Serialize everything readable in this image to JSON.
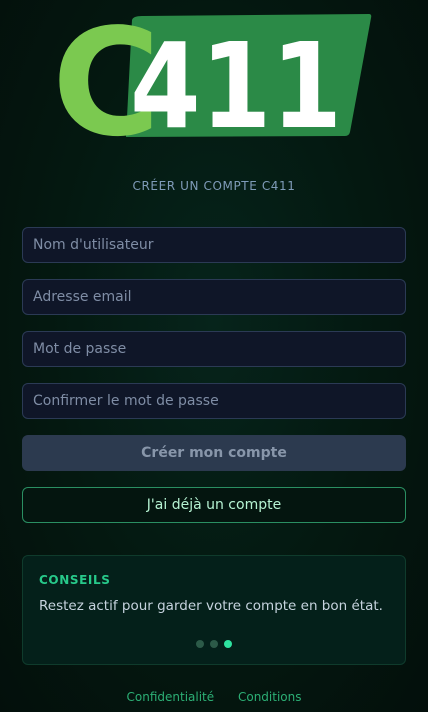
{
  "logo": {
    "letter": "C",
    "number": "411",
    "colors": {
      "c": "#7bc950",
      "panel": "#2b8a47",
      "number": "#ffffff"
    }
  },
  "subtitle": "CRÉER UN COMPTE C411",
  "form": {
    "username_placeholder": "Nom d'utilisateur",
    "email_placeholder": "Adresse email",
    "password_placeholder": "Mot de passe",
    "confirm_placeholder": "Confirmer le mot de passe",
    "submit_label": "Créer mon compte",
    "login_label": "J'ai déjà un compte"
  },
  "tips": {
    "title": "CONSEILS",
    "text": "Restez actif pour garder votre compte en bon état.",
    "total": 3,
    "active": 3
  },
  "footer": {
    "privacy": "Confidentialité",
    "terms": "Conditions"
  },
  "colors": {
    "accent": "#27c98a",
    "background": "#041810"
  }
}
